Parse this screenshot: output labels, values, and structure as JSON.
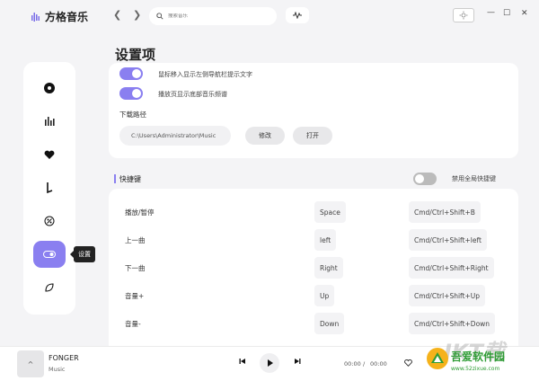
{
  "app": {
    "name": "方格音乐"
  },
  "search": {
    "placeholder": "搜索音乐"
  },
  "page_title": "设置项",
  "settings": {
    "option1": "鼠标移入显示左侧导航栏提示文字",
    "option2": "播放页显示底部音乐频谱",
    "download_label": "下载路径",
    "download_path": "C:\\Users\\Administrator\\Music",
    "modify_btn": "修改",
    "open_btn": "打开"
  },
  "shortcuts": {
    "section_title": "快捷键",
    "global_label": "禁用全局快捷键",
    "rows": [
      {
        "name": "播放/暂停",
        "key": "Space",
        "global": "Cmd/Ctrl+Shift+B"
      },
      {
        "name": "上一曲",
        "key": "left",
        "global": "Cmd/Ctrl+Shift+left"
      },
      {
        "name": "下一曲",
        "key": "Right",
        "global": "Cmd/Ctrl+Shift+Right"
      },
      {
        "name": "音量+",
        "key": "Up",
        "global": "Cmd/Ctrl+Shift+Up"
      },
      {
        "name": "音量-",
        "key": "Down",
        "global": "Cmd/Ctrl+Shift+Down"
      }
    ]
  },
  "sidebar": {
    "tooltip": "设置"
  },
  "player": {
    "cover_icon": "^",
    "song": "FONGER",
    "artist": "Music",
    "current_time": "00:00",
    "separator": "/",
    "total_time": "00:00"
  },
  "watermark": {
    "big": "IKT载",
    "name": "吾爱软件园",
    "url": "www.52zixue.com"
  },
  "colors": {
    "accent": "#8a7ff0"
  }
}
